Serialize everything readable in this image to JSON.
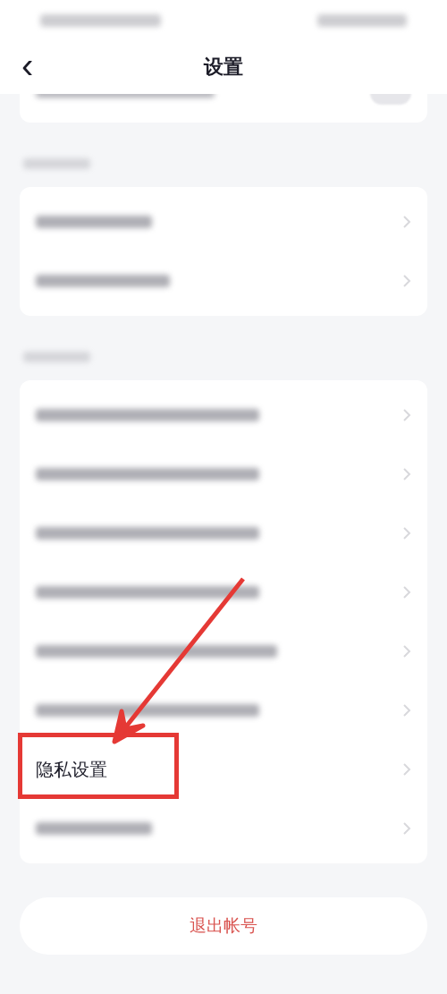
{
  "nav": {
    "title": "设置",
    "back": "‹"
  },
  "top_card": {
    "row": {
      "kind": "blurred",
      "on": false
    }
  },
  "sections": [
    {
      "heading": {
        "kind": "blurred"
      },
      "items": [
        {
          "kind": "blurred",
          "highlighted": false
        },
        {
          "kind": "blurred",
          "highlighted": false
        }
      ]
    },
    {
      "heading": {
        "kind": "blurred"
      },
      "items": [
        {
          "kind": "blurred",
          "highlighted": false
        },
        {
          "kind": "blurred",
          "highlighted": false
        },
        {
          "kind": "blurred",
          "highlighted": false
        },
        {
          "kind": "blurred",
          "highlighted": false
        },
        {
          "kind": "blurred",
          "highlighted": false
        },
        {
          "kind": "blurred",
          "highlighted": false
        },
        {
          "kind": "text",
          "label": "隐私设置",
          "highlighted": true
        },
        {
          "kind": "blurred",
          "highlighted": false
        }
      ]
    }
  ],
  "logout": {
    "label": "退出帐号"
  }
}
